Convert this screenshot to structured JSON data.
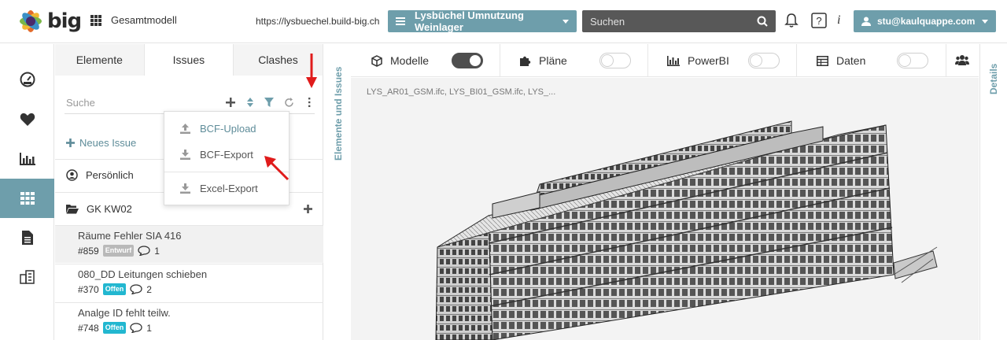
{
  "header": {
    "logo_text": "big",
    "model_label": "Gesamtmodell",
    "url": "https://lysbuechel.build-big.ch",
    "project": "Lysbüchel Umnutzung Weinlager",
    "search_placeholder": "Suchen",
    "info_label": "i",
    "user": "stu@kaulquappe.com"
  },
  "rail": {
    "items": [
      {
        "icon": "dashboard-icon"
      },
      {
        "icon": "heart-icon"
      },
      {
        "icon": "bar-chart-icon"
      },
      {
        "icon": "grid-icon",
        "active": true
      },
      {
        "icon": "document-icon"
      },
      {
        "icon": "building-icon"
      }
    ]
  },
  "panel": {
    "tabs": [
      "Elemente",
      "Issues",
      "Clashes"
    ],
    "active_tab": "Issues",
    "search_placeholder": "Suche",
    "new_issue": "Neues Issue",
    "groups": {
      "personal": "Persönlich",
      "folder": "GK KW02"
    },
    "issues": [
      {
        "title": "Räume Fehler SIA 416",
        "id": "#859",
        "status": "Entwurf",
        "comments": "1"
      },
      {
        "title": "080_DD Leitungen schieben",
        "id": "#370",
        "status": "Offen",
        "comments": "2"
      },
      {
        "title": "Analge ID fehlt teilw.",
        "id": "#748",
        "status": "Offen",
        "comments": "1"
      }
    ]
  },
  "menu": {
    "items": [
      "BCF-Upload",
      "BCF-Export",
      "Excel-Export"
    ]
  },
  "side_labels": {
    "left": "Elemente und Issues",
    "right": "Details"
  },
  "viewer": {
    "toolbar": {
      "models": "Modelle",
      "plans": "Pläne",
      "powerbi": "PowerBI",
      "data": "Daten"
    },
    "toggles": {
      "models": true,
      "plans": false,
      "powerbi": false,
      "data": false
    },
    "files": "LYS_AR01_GSM.ifc, LYS_BI01_GSM.ifc, LYS_..."
  },
  "colors": {
    "accent": "#6e9eab",
    "status_open": "#22b7d0",
    "status_draft": "#b9b9b9",
    "annotation_arrow": "#e01b1b"
  }
}
